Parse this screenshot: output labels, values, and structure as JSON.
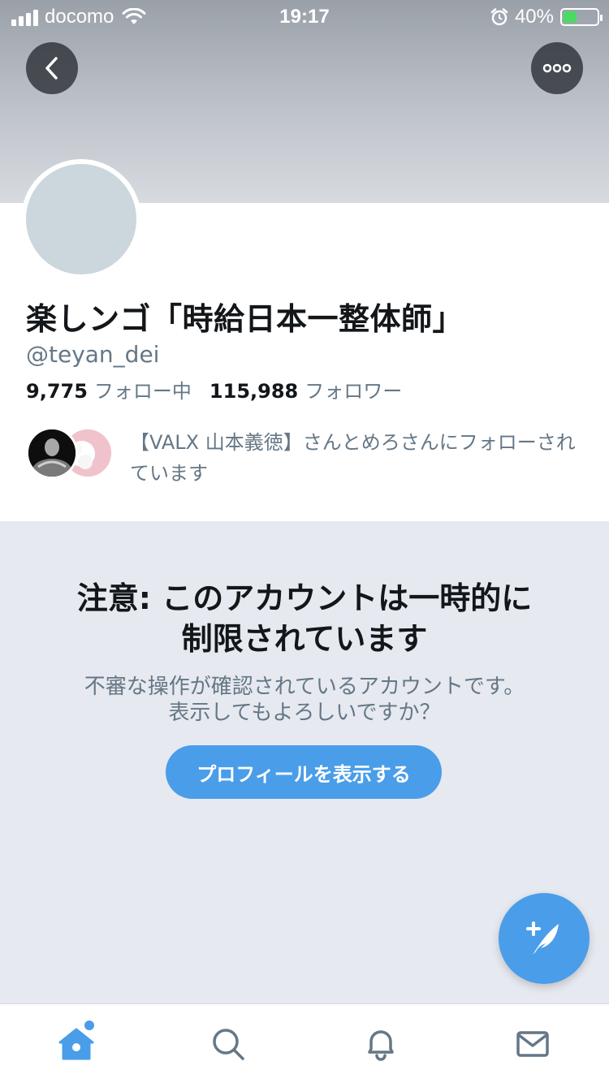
{
  "status_bar": {
    "carrier": "docomo",
    "time": "19:17",
    "battery": "40%",
    "battery_level": 0.4
  },
  "header": {
    "back_icon": "chevron-left-icon",
    "more_icon": "more-horizontal-icon"
  },
  "profile": {
    "display_name": "楽しンゴ「時給日本一整体師」",
    "handle": "@teyan_dei",
    "following_count": "9,775",
    "following_label": "フォロー中",
    "followers_count": "115,988",
    "followers_label": "フォロワー",
    "followed_by_text": "【VALX 山本義徳】さんとめろさんにフォローされています"
  },
  "warning": {
    "title_line1": "注意: このアカウントは一時的に",
    "title_line2": "制限されています",
    "subtitle_line1": "不審な操作が確認されているアカウントです。",
    "subtitle_line2": "表示してもよろしいですか？",
    "button_label": "プロフィールを表示する"
  },
  "tab_bar": {
    "items": [
      "home-icon",
      "search-icon",
      "notifications-icon",
      "messages-icon"
    ],
    "accent": "#4a9de9",
    "inactive": "#657786"
  },
  "compose_icon": "compose-tweet-icon"
}
